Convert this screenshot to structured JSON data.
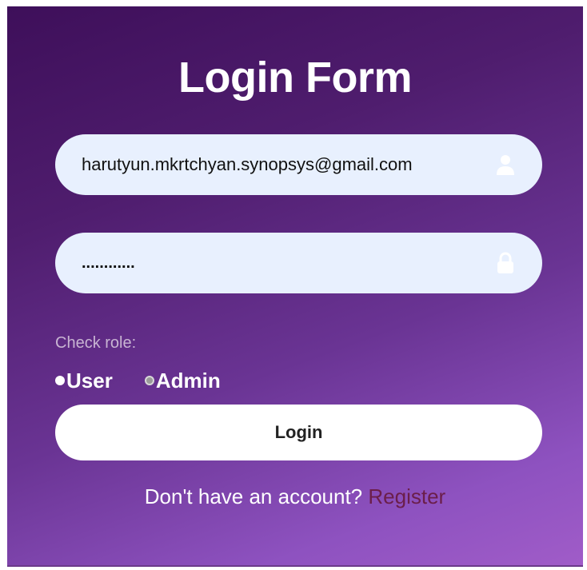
{
  "form": {
    "title": "Login Form",
    "email": {
      "value": "harutyun.mkrtchyan.synopsys@gmail.com",
      "icon": "user-icon"
    },
    "password": {
      "value": "............",
      "icon": "lock-icon"
    },
    "role": {
      "label": "Check role:",
      "options": [
        {
          "label": "User",
          "checked": true
        },
        {
          "label": "Admin",
          "checked": false
        }
      ]
    },
    "login_label": "Login",
    "register_prompt": "Don't have an account?",
    "register_link": "Register"
  },
  "colors": {
    "panel_gradient_start": "#3e0f5a",
    "panel_gradient_end": "#a05cc8",
    "input_background": "#e8f0fe",
    "role_label": "#c8b4d2",
    "register_link": "#6b1e4a"
  }
}
